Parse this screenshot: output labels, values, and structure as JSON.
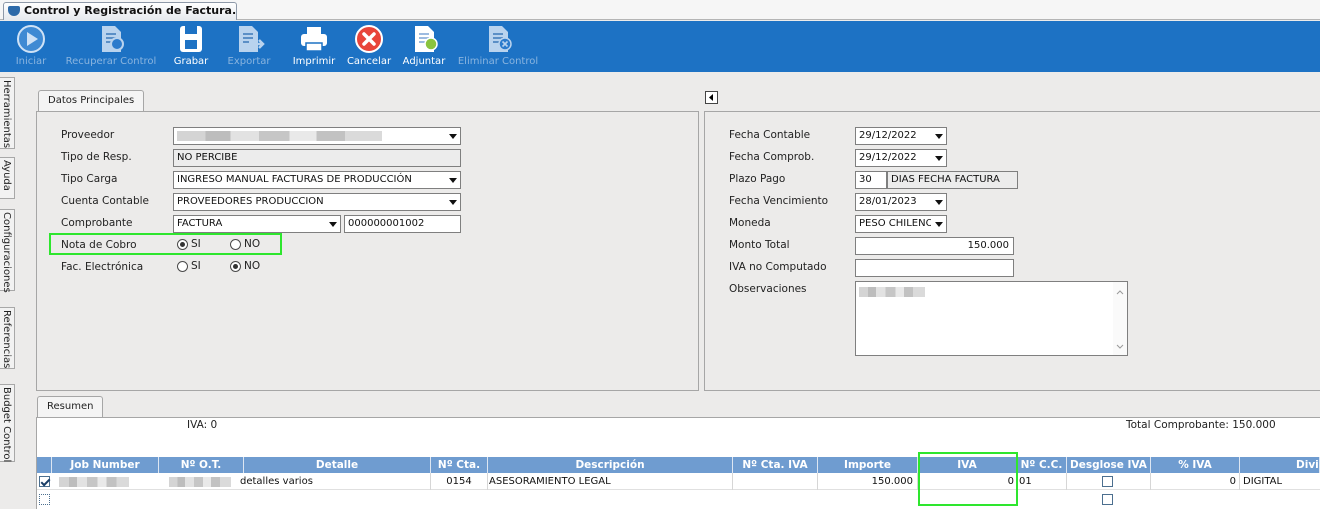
{
  "window_tab": {
    "title": "Control y Registración de Factura..."
  },
  "toolbar": {
    "iniciar": "Iniciar",
    "recuperar": "Recuperar Control",
    "grabar": "Grabar",
    "exportar": "Exportar",
    "imprimir": "Imprimir",
    "cancelar": "Cancelar",
    "adjuntar": "Adjuntar",
    "eliminar": "Eliminar Control"
  },
  "sidebar": {
    "tabs": [
      "Herramientas",
      "Ayuda",
      "Configuraciones",
      "Referencias",
      "Budget Control"
    ]
  },
  "principal": {
    "tab_label": "Datos Principales",
    "proveedor_label": "Proveedor",
    "tipo_resp_label": "Tipo de Resp.",
    "tipo_resp_value": "NO PERCIBE",
    "tipo_carga_label": "Tipo Carga",
    "tipo_carga_value": "INGRESO MANUAL FACTURAS DE PRODUCCIÓN",
    "cuenta_label": "Cuenta Contable",
    "cuenta_value": "PROVEEDORES PRODUCCION",
    "comprobante_label": "Comprobante",
    "comprobante_type": "FACTURA",
    "comprobante_number": "000000001002",
    "nota_cobro_label": "Nota de Cobro",
    "fac_electronica_label": "Fac. Electrónica",
    "si": "SI",
    "no": "NO"
  },
  "right": {
    "fecha_contable_label": "Fecha Contable",
    "fecha_contable": "29/12/2022",
    "fecha_comprob_label": "Fecha Comprob.",
    "fecha_comprob": "29/12/2022",
    "plazo_label": "Plazo Pago",
    "plazo_days": "30",
    "plazo_desc": "DIAS FECHA FACTURA",
    "vencimiento_label": "Fecha Vencimiento",
    "vencimiento": "28/01/2023",
    "moneda_label": "Moneda",
    "moneda": "PESO CHILENO",
    "monto_label": "Monto Total",
    "monto": "150.000",
    "iva_no_label": "IVA no Computado",
    "iva_no": "",
    "obs_label": "Observaciones"
  },
  "resumen": {
    "tab_label": "Resumen",
    "iva_label": "IVA: 0",
    "total_label": "Total Comprobante: 150.000"
  },
  "grid": {
    "columns": [
      "Job Number",
      "Nº O.T.",
      "Detalle",
      "Nº Cta.",
      "Descripción",
      "Nº Cta. IVA",
      "Importe",
      "IVA",
      "Nº C.C.",
      "Desglose IVA",
      "% IVA",
      "Divis"
    ],
    "rows": [
      {
        "detalle": "detalles varios",
        "cta": "0154",
        "descripcion": "ASESORAMIENTO LEGAL",
        "cta_iva": "",
        "importe": "150.000",
        "iva": "0",
        "cc": "01",
        "pct_iva": "0",
        "divis": "DIGITAL"
      }
    ]
  },
  "colors": {
    "toolbar": "#1d72c4",
    "grid_header": "#6f9cd0",
    "highlight": "#2ee62e"
  }
}
